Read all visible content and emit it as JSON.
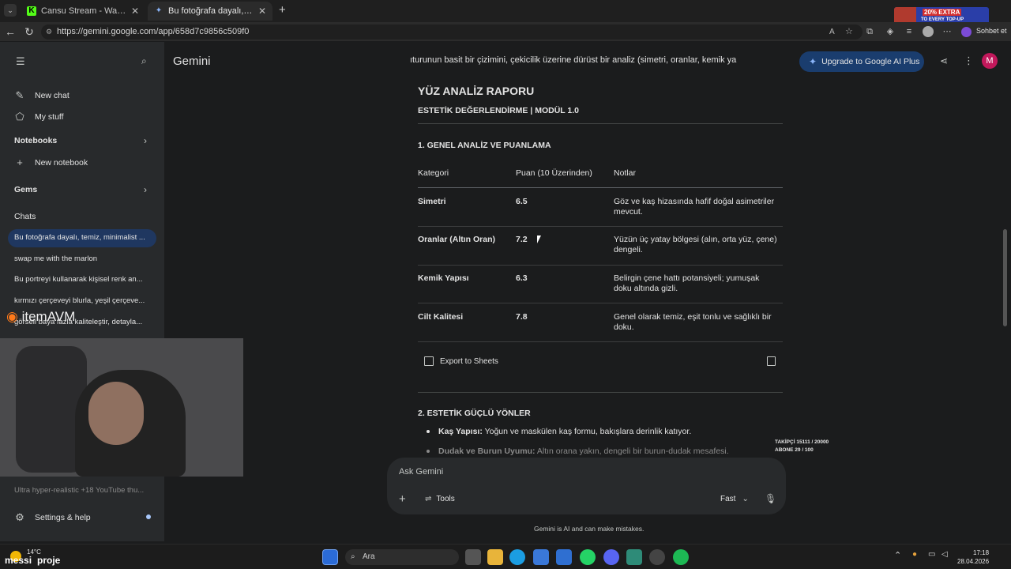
{
  "browser": {
    "tabs": [
      {
        "label": "Cansu Stream - Watch Live on Kick",
        "active": false
      },
      {
        "label": "Bu fotoğrafa dayalı, temiz, minimalist",
        "active": true
      }
    ],
    "url": "https://gemini.google.com/app/658d7c9856c509f0",
    "profile_label": "Sohbet et",
    "ad_text": "20% EXTRA",
    "ad_subtext": "TO EVERY TOP-UP"
  },
  "sidebar": {
    "new_chat": "New chat",
    "my_stuff": "My stuff",
    "notebooks": "Notebooks",
    "new_notebook": "New notebook",
    "gems": "Gems",
    "chats_heading": "Chats",
    "chats": [
      "Bu fotoğrafa dayalı, temiz, minimalist ...",
      "swap me with the marlon",
      "Bu portreyi kullanarak kişisel renk an...",
      "kırmızı çerçeveyi blurla, yeşil çerçeve...",
      "görseli baya fazla kaliteleştir, detayla...",
      "Ultra hyper-realistic +18 YouTube thu..."
    ],
    "settings": "Settings & help"
  },
  "header": {
    "app_name": "Gemini",
    "prompt_excerpt": "ıturunun basit bir çizimini, çekicilik üzerine dürüst bir analiz (simetri, oranlar, kemik ya",
    "upgrade_label": "Upgrade to Google AI Plus",
    "avatar_letter": "M"
  },
  "report": {
    "title": "YÜZ ANALİZ RAPORU",
    "subtitle": "ESTETİK DEĞERLENDİRME | MODÜL 1.0",
    "section1": "1. GENEL ANALİZ VE PUANLAMA",
    "columns": [
      "Kategori",
      "Puan (10 Üzerinden)",
      "Notlar"
    ],
    "rows": [
      {
        "category": "Simetri",
        "score": "6.5",
        "note_l1": "Göz ve kaş hizasında hafif doğal asimetriler",
        "note_l2": "mevcut."
      },
      {
        "category": "Oranlar (Altın Oran)",
        "score": "7.2",
        "note_l1": "Yüzün üç yatay bölgesi (alın, orta yüz, çene)",
        "note_l2": "dengeli."
      },
      {
        "category": "Kemik Yapısı",
        "score": "6.3",
        "note_l1": "Belirgin çene hattı potansiyeli; yumuşak",
        "note_l2": "doku altında gizli."
      },
      {
        "category": "Cilt Kalitesi",
        "score": "7.8",
        "note_l1": "Genel olarak temiz, eşit tonlu ve sağlıklı bir",
        "note_l2": "doku."
      }
    ],
    "export_label": "Export to Sheets",
    "section2": "2. ESTETİK GÜÇLÜ YÖNLER",
    "bullets": [
      {
        "bold": "Kaş Yapısı:",
        "text": " Yoğun ve maskülen kaş formu, bakışlara derinlik katıyor."
      },
      {
        "bold": "Dudak ve Burun Uyumu:",
        "text": " Altın orana yakın, dengeli bir burun-dudak mesafesi."
      }
    ]
  },
  "composer": {
    "placeholder": "Ask Gemini",
    "tools_label": "Tools",
    "mode_label": "Fast",
    "disclaimer": "Gemini is AI and can make mistakes."
  },
  "overlay": {
    "brand": "itemAVM",
    "followers": "TAKİPÇİ 15111 / 20000",
    "subscribers": "ABONE 29 / 100",
    "streamer_label": "messi",
    "streamer_label2": "proje"
  },
  "taskbar": {
    "search_label": "Ara",
    "weather": "14°C",
    "time": "17:18",
    "date": "28.04.2026"
  }
}
